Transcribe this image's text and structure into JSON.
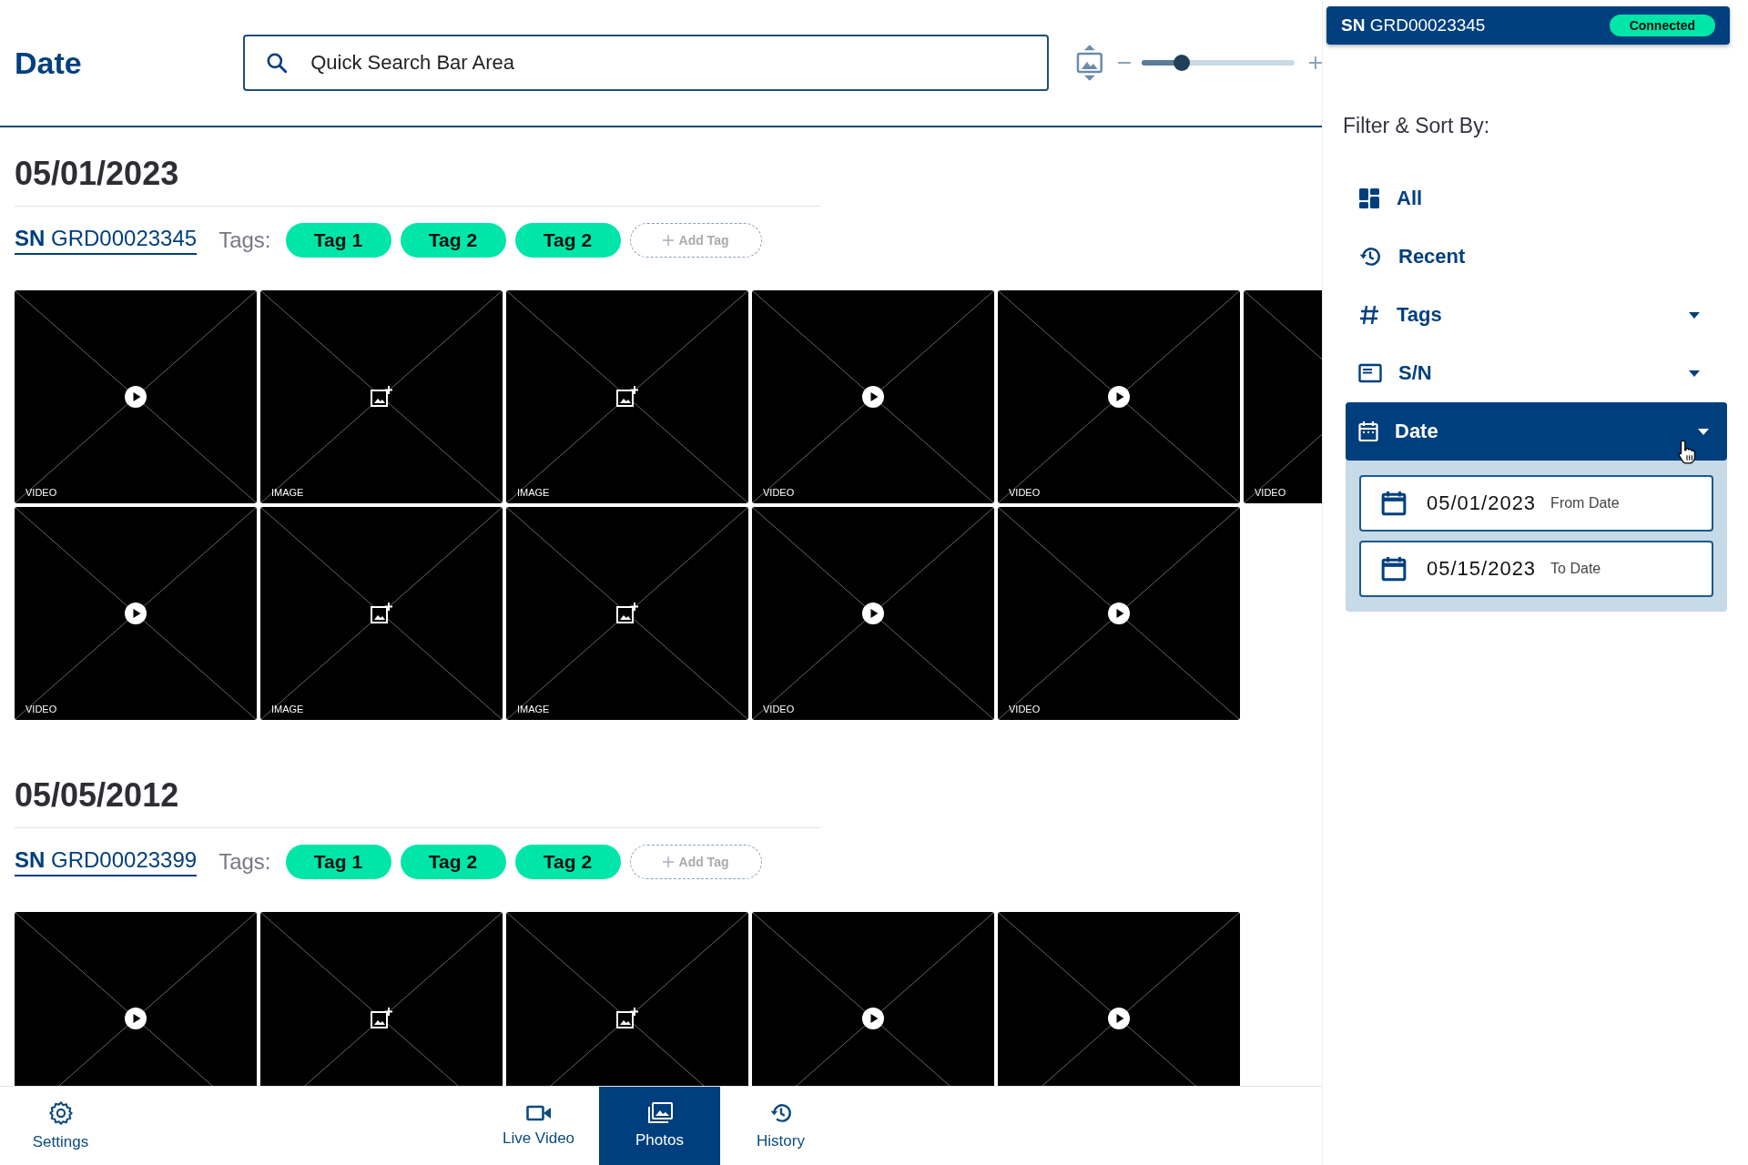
{
  "header": {
    "title": "Date",
    "search": {
      "value": "Quick Search Bar Area"
    },
    "thumb_size": {
      "level": 0.26
    }
  },
  "sections": [
    {
      "date": "05/01/2023",
      "serial": "**SN** GRD00023345",
      "tags_label": "Tags:",
      "tags": [
        "Tag 1",
        "Tag 2",
        "Tag 2"
      ],
      "add_tag": "Add Tag",
      "rows": [
        [
          {
            "kind": "video",
            "label": "VIDEO"
          },
          {
            "kind": "image",
            "label": "IMAGE"
          },
          {
            "kind": "image",
            "label": "IMAGE"
          },
          {
            "kind": "video",
            "label": "VIDEO"
          },
          {
            "kind": "video",
            "label": "VIDEO"
          },
          {
            "kind": "video",
            "label": "VIDEO"
          }
        ],
        [
          {
            "kind": "video",
            "label": "VIDEO"
          },
          {
            "kind": "image",
            "label": "IMAGE"
          },
          {
            "kind": "image",
            "label": "IMAGE"
          },
          {
            "kind": "video",
            "label": "VIDEO"
          },
          {
            "kind": "video",
            "label": "VIDEO"
          }
        ]
      ]
    },
    {
      "date": "05/05/2012",
      "serial": "**SN** GRD00023399",
      "tags_label": "Tags:",
      "tags": [
        "Tag 1",
        "Tag 2",
        "Tag 2"
      ],
      "add_tag": "Add Tag",
      "rows": [
        [
          {
            "kind": "video"
          },
          {
            "kind": "image"
          },
          {
            "kind": "image"
          },
          {
            "kind": "video"
          },
          {
            "kind": "video"
          }
        ]
      ]
    }
  ],
  "bottom_nav": [
    {
      "kind": "settings",
      "label": "Settings",
      "selected": false
    },
    {
      "kind": "live",
      "label": "Live Video",
      "selected": false
    },
    {
      "kind": "photos",
      "label": "Photos",
      "selected": true
    },
    {
      "kind": "history",
      "label": "History",
      "selected": false
    }
  ],
  "device": {
    "serial": "**SN** GRD00023345",
    "status": "Connected"
  },
  "filter": {
    "title": "Filter & Sort By:",
    "items": [
      {
        "kind": "all",
        "label": "All",
        "dropdown": false,
        "selected": false
      },
      {
        "kind": "recent",
        "label": "Recent",
        "dropdown": false,
        "selected": false
      },
      {
        "kind": "tags",
        "label": "Tags",
        "dropdown": true,
        "selected": false
      },
      {
        "kind": "sn",
        "label": "S/N",
        "dropdown": true,
        "selected": false
      },
      {
        "kind": "date",
        "label": "Date",
        "dropdown": true,
        "selected": true,
        "fields": [
          {
            "value": "05/01/2023",
            "hint": "From Date"
          },
          {
            "value": "05/15/2023",
            "hint": "To Date"
          }
        ]
      }
    ]
  }
}
